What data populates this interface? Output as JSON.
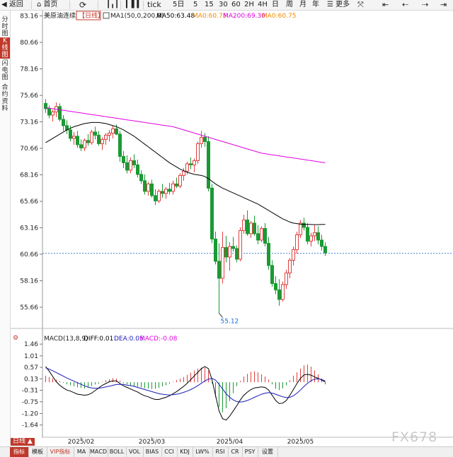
{
  "toolbar": {
    "back": "返回",
    "home": "首页",
    "refresh_icon": "refresh-icon",
    "tick": "tick",
    "d5": "5日",
    "m5": "5",
    "m15": "15",
    "m30": "30",
    "m60": "60",
    "h2": "2H",
    "h4": "4H",
    "day": "日",
    "week": "周",
    "month": "月",
    "year": "年",
    "more": "更多"
  },
  "sidebar": {
    "items": [
      {
        "label": "分时图",
        "active": false
      },
      {
        "label": "K线图",
        "active": true
      },
      {
        "label": "闪电图",
        "active": false
      },
      {
        "label": "合约资料",
        "active": false
      }
    ]
  },
  "colors": {
    "up": "#e0403f",
    "down": "#1a9a33",
    "ma50": "#000000",
    "ma200": "#e100e1",
    "ma0": "#f08a00",
    "dif": "#000000",
    "dea": "#1a1ab8"
  },
  "chart_data": [
    {
      "type": "candlestick",
      "header": {
        "symbol": "美原油连续",
        "period_badge": "日线",
        "ma_params": "MA1(50,0,200,0)",
        "ma50": "MA50:63.48",
        "ma0a": "MA0:60.75",
        "ma200": "MA200:69.30",
        "ma0b": "MA0:60.75"
      },
      "y_ticks": [
        83.16,
        80.66,
        78.16,
        75.66,
        73.16,
        70.66,
        68.16,
        65.66,
        63.16,
        60.66,
        58.16,
        55.66
      ],
      "ylim": [
        53.66,
        83.66
      ],
      "current_price": 60.75,
      "min_label": "55.12",
      "x_labels": [
        "2025/02",
        "2025/03",
        "2025/04",
        "2025/05"
      ],
      "candles_ohlc": [
        [
          74.9,
          75.3,
          74.0,
          74.4
        ],
        [
          74.4,
          74.7,
          73.5,
          73.8
        ],
        [
          73.8,
          74.3,
          73.2,
          74.1
        ],
        [
          74.1,
          75.0,
          73.6,
          74.6
        ],
        [
          74.6,
          74.9,
          73.2,
          73.4
        ],
        [
          73.4,
          73.8,
          72.3,
          72.8
        ],
        [
          72.8,
          73.3,
          72.0,
          72.4
        ],
        [
          72.4,
          72.8,
          71.3,
          71.6
        ],
        [
          71.6,
          72.2,
          71.0,
          71.8
        ],
        [
          71.8,
          72.3,
          70.7,
          71.0
        ],
        [
          71.0,
          71.5,
          70.4,
          70.7
        ],
        [
          70.7,
          71.6,
          70.4,
          71.4
        ],
        [
          71.4,
          72.0,
          70.9,
          71.2
        ],
        [
          71.2,
          72.4,
          71.0,
          72.2
        ],
        [
          72.2,
          72.7,
          71.5,
          71.9
        ],
        [
          71.9,
          72.3,
          70.9,
          71.1
        ],
        [
          71.1,
          71.7,
          70.5,
          71.5
        ],
        [
          71.5,
          72.1,
          71.0,
          71.9
        ],
        [
          71.9,
          72.4,
          71.3,
          72.1
        ],
        [
          72.1,
          72.8,
          71.6,
          72.5
        ],
        [
          72.5,
          72.9,
          71.9,
          72.0
        ],
        [
          72.0,
          72.3,
          69.4,
          69.9
        ],
        [
          69.9,
          70.4,
          68.8,
          69.3
        ],
        [
          69.3,
          70.0,
          68.3,
          68.6
        ],
        [
          68.6,
          69.8,
          68.3,
          69.5
        ],
        [
          69.5,
          70.1,
          68.8,
          69.1
        ],
        [
          69.1,
          69.6,
          67.9,
          68.2
        ],
        [
          68.2,
          68.6,
          67.3,
          67.6
        ],
        [
          67.6,
          68.2,
          66.3,
          66.6
        ],
        [
          66.6,
          67.5,
          66.2,
          67.3
        ],
        [
          67.3,
          67.7,
          66.0,
          66.2
        ],
        [
          66.2,
          66.8,
          65.3,
          65.7
        ],
        [
          65.7,
          66.8,
          65.5,
          66.6
        ],
        [
          66.6,
          67.3,
          66.0,
          66.4
        ],
        [
          66.4,
          67.0,
          65.9,
          66.8
        ],
        [
          66.8,
          67.4,
          66.3,
          66.6
        ],
        [
          66.6,
          67.6,
          66.3,
          67.3
        ],
        [
          67.3,
          67.9,
          66.9,
          67.1
        ],
        [
          67.1,
          68.3,
          66.9,
          68.1
        ],
        [
          68.1,
          68.8,
          67.6,
          68.5
        ],
        [
          68.5,
          69.4,
          68.2,
          69.2
        ],
        [
          69.2,
          69.8,
          68.7,
          69.1
        ],
        [
          69.1,
          69.7,
          68.4,
          69.5
        ],
        [
          69.5,
          71.3,
          69.2,
          71.1
        ],
        [
          71.1,
          72.3,
          70.7,
          71.7
        ],
        [
          71.7,
          72.1,
          70.8,
          71.3
        ],
        [
          71.3,
          71.8,
          66.6,
          66.9
        ],
        [
          66.9,
          67.3,
          61.7,
          62.1
        ],
        [
          62.1,
          62.8,
          59.7,
          60.0
        ],
        [
          60.0,
          61.7,
          55.1,
          58.4
        ],
        [
          58.4,
          62.8,
          57.9,
          61.3
        ],
        [
          61.3,
          62.4,
          59.9,
          60.4
        ],
        [
          60.4,
          61.8,
          59.1,
          61.4
        ],
        [
          61.4,
          62.3,
          60.9,
          61.2
        ],
        [
          61.2,
          61.5,
          59.9,
          60.2
        ],
        [
          60.2,
          63.2,
          60.0,
          62.9
        ],
        [
          62.9,
          64.4,
          62.6,
          63.9
        ],
        [
          63.9,
          64.8,
          62.4,
          62.6
        ],
        [
          62.6,
          63.8,
          62.2,
          63.6
        ],
        [
          63.6,
          64.3,
          62.4,
          62.6
        ],
        [
          62.6,
          63.4,
          61.6,
          62.0
        ],
        [
          62.0,
          63.3,
          61.8,
          63.1
        ],
        [
          63.1,
          63.6,
          61.4,
          61.7
        ],
        [
          61.7,
          62.3,
          59.2,
          59.6
        ],
        [
          59.6,
          60.1,
          57.6,
          57.9
        ],
        [
          57.9,
          58.6,
          56.9,
          57.3
        ],
        [
          57.3,
          58.3,
          55.8,
          56.4
        ],
        [
          56.4,
          58.1,
          56.2,
          57.8
        ],
        [
          57.8,
          59.2,
          57.4,
          58.9
        ],
        [
          58.9,
          60.3,
          58.4,
          60.1
        ],
        [
          60.1,
          61.4,
          59.6,
          61.1
        ],
        [
          61.1,
          62.8,
          60.7,
          62.5
        ],
        [
          62.5,
          63.9,
          62.2,
          63.6
        ],
        [
          63.6,
          64.1,
          62.9,
          63.2
        ],
        [
          63.2,
          63.6,
          61.6,
          61.9
        ],
        [
          61.9,
          62.7,
          61.4,
          62.4
        ],
        [
          62.4,
          63.4,
          61.9,
          62.7
        ],
        [
          62.7,
          63.3,
          61.6,
          62.0
        ],
        [
          62.0,
          62.5,
          61.0,
          61.4
        ],
        [
          61.4,
          61.8,
          60.5,
          60.8
        ]
      ],
      "ma50": [
        71.2,
        71.4,
        71.6,
        71.8,
        72.0,
        72.2,
        72.4,
        72.55,
        72.7,
        72.8,
        72.9,
        73.0,
        73.05,
        73.1,
        73.1,
        73.1,
        73.05,
        73.0,
        72.9,
        72.8,
        72.7,
        72.55,
        72.4,
        72.2,
        72.0,
        71.8,
        71.55,
        71.3,
        71.05,
        70.8,
        70.55,
        70.3,
        70.05,
        69.8,
        69.55,
        69.3,
        69.1,
        68.9,
        68.7,
        68.55,
        68.4,
        68.3,
        68.2,
        68.15,
        68.1,
        68.0,
        67.8,
        67.55,
        67.3,
        67.1,
        66.9,
        66.75,
        66.6,
        66.45,
        66.3,
        66.15,
        66.0,
        65.85,
        65.7,
        65.55,
        65.4,
        65.2,
        65.0,
        64.8,
        64.6,
        64.4,
        64.2,
        64.0,
        63.85,
        63.7,
        63.6,
        63.55,
        63.5,
        63.48,
        63.47,
        63.47,
        63.46,
        63.46,
        63.47,
        63.48
      ],
      "ma200": [
        74.5,
        74.45,
        74.4,
        74.35,
        74.3,
        74.25,
        74.2,
        74.15,
        74.1,
        74.05,
        74.0,
        73.95,
        73.9,
        73.85,
        73.8,
        73.75,
        73.7,
        73.65,
        73.6,
        73.55,
        73.5,
        73.45,
        73.4,
        73.35,
        73.3,
        73.25,
        73.2,
        73.15,
        73.1,
        73.05,
        73.0,
        72.95,
        72.9,
        72.85,
        72.8,
        72.75,
        72.7,
        72.6,
        72.5,
        72.4,
        72.3,
        72.2,
        72.1,
        72.0,
        71.9,
        71.8,
        71.7,
        71.6,
        71.5,
        71.4,
        71.3,
        71.2,
        71.1,
        71.0,
        70.9,
        70.8,
        70.7,
        70.6,
        70.5,
        70.4,
        70.3,
        70.2,
        70.15,
        70.1,
        70.05,
        70.0,
        69.95,
        69.9,
        69.85,
        69.8,
        69.75,
        69.7,
        69.65,
        69.6,
        69.55,
        69.5,
        69.45,
        69.4,
        69.35,
        69.3
      ]
    },
    {
      "type": "macd",
      "header": {
        "params": "MACD(13,8,9)",
        "diff": "DIFF:0.01",
        "dea": "DEA:0.05",
        "macd": "MACD:-0.08"
      },
      "y_ticks": [
        1.46,
        1.01,
        0.57,
        0.13,
        -0.31,
        -0.75,
        -1.2,
        -1.64
      ],
      "ylim": [
        -2.0,
        1.6
      ],
      "diff": [
        0.6,
        0.42,
        0.22,
        0.02,
        -0.12,
        -0.22,
        -0.3,
        -0.34,
        -0.4,
        -0.46,
        -0.48,
        -0.5,
        -0.48,
        -0.42,
        -0.32,
        -0.22,
        -0.12,
        -0.05,
        0.02,
        0.05,
        0.05,
        -0.05,
        -0.14,
        -0.2,
        -0.26,
        -0.32,
        -0.38,
        -0.46,
        -0.52,
        -0.56,
        -0.62,
        -0.66,
        -0.66,
        -0.62,
        -0.58,
        -0.52,
        -0.44,
        -0.36,
        -0.26,
        -0.16,
        -0.04,
        0.1,
        0.24,
        0.38,
        0.52,
        0.6,
        0.52,
        0.1,
        -0.5,
        -1.1,
        -1.4,
        -1.45,
        -1.3,
        -1.1,
        -0.9,
        -0.68,
        -0.5,
        -0.38,
        -0.28,
        -0.22,
        -0.2,
        -0.18,
        -0.2,
        -0.3,
        -0.5,
        -0.7,
        -0.82,
        -0.8,
        -0.7,
        -0.5,
        -0.28,
        -0.05,
        0.15,
        0.28,
        0.3,
        0.27,
        0.2,
        0.15,
        0.08,
        0.01
      ],
      "dea": [
        0.55,
        0.5,
        0.44,
        0.37,
        0.3,
        0.23,
        0.16,
        0.1,
        0.04,
        -0.02,
        -0.08,
        -0.14,
        -0.19,
        -0.22,
        -0.23,
        -0.23,
        -0.21,
        -0.18,
        -0.15,
        -0.12,
        -0.09,
        -0.08,
        -0.09,
        -0.11,
        -0.13,
        -0.16,
        -0.2,
        -0.24,
        -0.28,
        -0.32,
        -0.36,
        -0.4,
        -0.44,
        -0.46,
        -0.48,
        -0.49,
        -0.48,
        -0.46,
        -0.43,
        -0.39,
        -0.34,
        -0.28,
        -0.21,
        -0.13,
        -0.04,
        0.05,
        0.12,
        0.15,
        0.08,
        -0.08,
        -0.26,
        -0.44,
        -0.58,
        -0.68,
        -0.74,
        -0.76,
        -0.74,
        -0.7,
        -0.64,
        -0.58,
        -0.52,
        -0.46,
        -0.42,
        -0.4,
        -0.42,
        -0.46,
        -0.51,
        -0.56,
        -0.59,
        -0.58,
        -0.52,
        -0.42,
        -0.3,
        -0.16,
        -0.04,
        0.06,
        0.12,
        0.13,
        0.1,
        0.05
      ],
      "hist": [
        0.25,
        0.2,
        0.15,
        0.1,
        0.05,
        -0.02,
        -0.08,
        -0.12,
        -0.16,
        -0.2,
        -0.22,
        -0.24,
        -0.2,
        -0.15,
        -0.09,
        -0.05,
        0.02,
        0.08,
        0.12,
        0.16,
        0.14,
        0.06,
        -0.04,
        -0.08,
        -0.12,
        -0.15,
        -0.18,
        -0.2,
        -0.23,
        -0.24,
        -0.26,
        -0.25,
        -0.22,
        -0.16,
        -0.12,
        -0.06,
        0.02,
        0.08,
        0.14,
        0.2,
        0.28,
        0.36,
        0.45,
        0.52,
        0.56,
        0.55,
        0.44,
        -0.05,
        -0.58,
        -0.95,
        -1.15,
        -1.0,
        -0.72,
        -0.42,
        -0.15,
        0.05,
        0.22,
        0.32,
        0.4,
        0.42,
        0.38,
        0.3,
        0.22,
        0.1,
        -0.08,
        -0.25,
        -0.3,
        -0.24,
        -0.12,
        0.08,
        0.25,
        0.38,
        0.52,
        0.65,
        0.68,
        0.6,
        0.45,
        0.3,
        0.15,
        -0.08
      ]
    }
  ],
  "bottombar": {
    "period": "日线 ▲",
    "items": [
      "指标",
      "模板",
      "VIP指标",
      "MA",
      "MACD",
      "BOLL",
      "VOL",
      "BIAS",
      "CCI",
      "KDJ",
      "LW%",
      "RSI",
      "CR",
      "PSY",
      "设置"
    ]
  },
  "watermark": "FX678"
}
